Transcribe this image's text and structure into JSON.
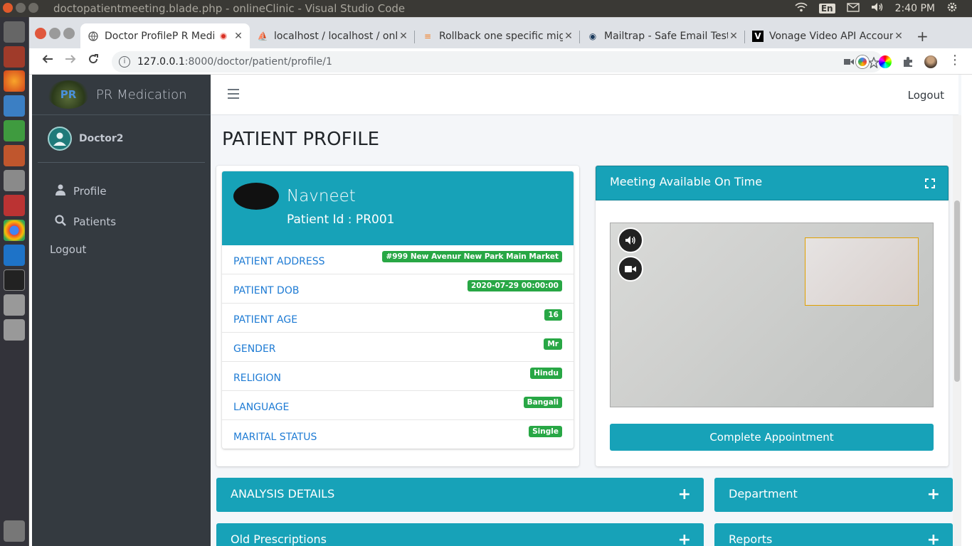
{
  "os": {
    "window_title": "doctopatientmeeting.blade.php - onlineClinic - Visual Studio Code",
    "keyboard": "En",
    "clock": "2:40 PM"
  },
  "browser": {
    "tabs": [
      {
        "label": "Doctor ProfileP R Medication",
        "active": true
      },
      {
        "label": "localhost / localhost / onlineClinic"
      },
      {
        "label": "Rollback one specific migration"
      },
      {
        "label": "Mailtrap - Safe Email Testing"
      },
      {
        "label": "Vonage Video API Account"
      }
    ],
    "url_host": "127.0.0.1",
    "url_path": ":8000/doctor/patient/profile/1"
  },
  "sidebar": {
    "brand": "PR Medication",
    "logo_text": "PR",
    "user": "Doctor2",
    "items": [
      {
        "label": "Profile"
      },
      {
        "label": "Patients"
      },
      {
        "label": "Logout"
      }
    ]
  },
  "header": {
    "logout": "Logout"
  },
  "main": {
    "title": "PATIENT PROFILE",
    "patient": {
      "name": "Navneet",
      "id": "Patient Id : PR001",
      "fields": [
        {
          "label": "PATIENT ADDRESS",
          "value": "#999 New Avenur New Park Main Market"
        },
        {
          "label": "PATIENT DOB",
          "value": "2020-07-29 00:00:00"
        },
        {
          "label": "PATIENT AGE",
          "value": "16"
        },
        {
          "label": "GENDER",
          "value": "Mr"
        },
        {
          "label": "RELIGION",
          "value": "Hindu"
        },
        {
          "label": "LANGUAGE",
          "value": "Bangali"
        },
        {
          "label": "MARITAL STATUS",
          "value": "Single"
        }
      ]
    },
    "meeting": {
      "title": "Meeting Available On Time",
      "complete_button": "Complete Appointment"
    },
    "sections": [
      {
        "title": "ANALYSIS DETAILS"
      },
      {
        "title": "Department"
      },
      {
        "title": "Old Prescriptions"
      },
      {
        "title": "Reports"
      }
    ]
  },
  "colors": {
    "accent": "#17a2b8",
    "sidebar": "#343a40",
    "badge": "#28a745",
    "link": "#1e7bd4"
  }
}
